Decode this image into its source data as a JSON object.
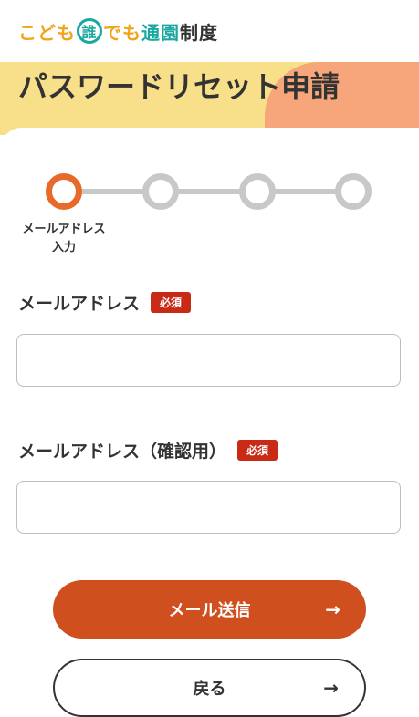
{
  "header": {
    "logo_part1": "こども",
    "logo_circle": "誰",
    "logo_part2": "でも",
    "logo_part3": "通園",
    "logo_part4": "制度"
  },
  "page": {
    "title": "パスワードリセット申請"
  },
  "stepper": {
    "steps": [
      {
        "label": "メールアドレス\n入力",
        "active": true
      },
      {
        "label": "",
        "active": false
      },
      {
        "label": "",
        "active": false
      },
      {
        "label": "",
        "active": false
      }
    ],
    "active_label_line1": "メールアドレス",
    "active_label_line2": "入力"
  },
  "form": {
    "email_label": "メールアドレス",
    "email_confirm_label": "メールアドレス（確認用）",
    "required_badge": "必須",
    "email_value": "",
    "email_confirm_value": ""
  },
  "buttons": {
    "send_label": "メール送信",
    "back_label": "戻る",
    "arrow": "→"
  },
  "colors": {
    "accent": "#cf4f1f",
    "step_active": "#e86a2a",
    "required": "#c92a16",
    "hero_yellow": "#f8df8a",
    "hero_peach": "#f6a67a"
  }
}
